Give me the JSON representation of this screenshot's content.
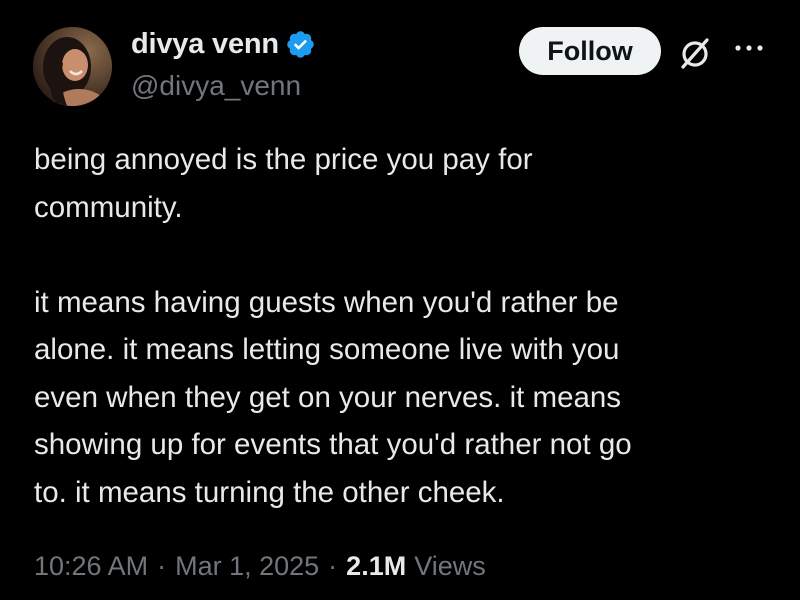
{
  "author": {
    "display_name": "divya venn",
    "handle": "@divya_venn",
    "verified_color": "#1d9bf0"
  },
  "header": {
    "follow_label": "Follow",
    "grok_icon": "grok-icon",
    "more_icon": "more-icon"
  },
  "tweet": {
    "text": "being annoyed is the price you pay for\ncommunity.\n\nit means having guests when you'd rather be\nalone. it means letting someone live with you\neven when they get on your nerves. it means\nshowing up for events that you'd rather not go\nto. it means turning the other cheek."
  },
  "meta": {
    "time": "10:26 AM",
    "separator": "·",
    "date": "Mar 1, 2025",
    "views_count": "2.1M",
    "views_label": "Views"
  },
  "colors": {
    "background": "#000000",
    "text_primary": "#e7e9ea",
    "text_secondary": "#71767b",
    "button_bg": "#eff3f4"
  }
}
